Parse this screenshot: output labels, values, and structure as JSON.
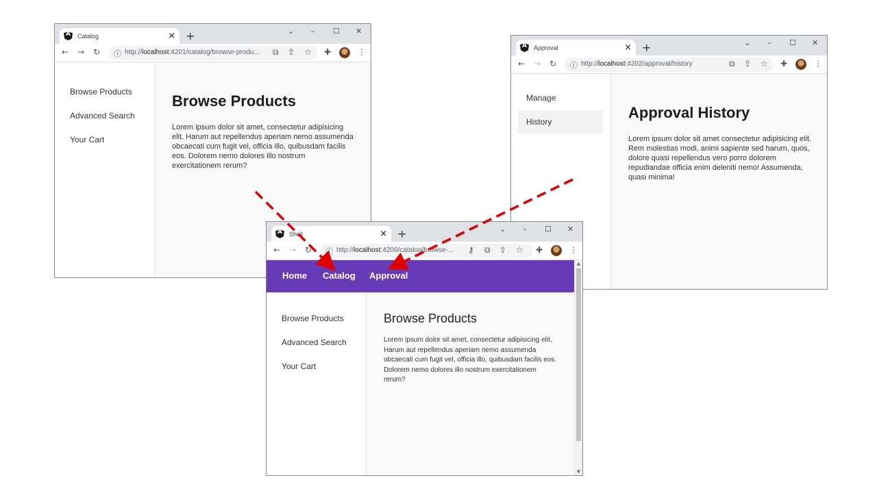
{
  "catalog_window": {
    "tab_title": "Catalog",
    "url_prefix": "http://",
    "url_host": "localhost",
    "url_rest": ":4201/catalog/browse-produ...",
    "nav": [
      "Browse Products",
      "Advanced Search",
      "Your Cart"
    ],
    "heading": "Browse Products",
    "body": "Lorem ipsum dolor sit amet, consectetur adipisicing elit. Harum aut repellendus aperiam nemo assumenda obcaecati cum fugit vel, officia illo, quibusdam facilis eos. Dolorem nemo dolores illo nostrum exercitationem rerum?"
  },
  "approval_window": {
    "tab_title": "Approval",
    "url_prefix": "http://",
    "url_host": "localhost",
    "url_rest": ":4202/approval/history",
    "nav": [
      "Manage",
      "History"
    ],
    "active_nav": "History",
    "heading": "Approval History",
    "body": "Lorem ipsum dolor sit amet consectetur adipisicing elit. Rem molestias modi, animi sapiente sed harum, quos, dolore quasi repellendus vero porro dolorem repudiandae officia enim deleniti nemo! Assumenda, quasi minima!"
  },
  "shell_window": {
    "tab_title": "Shell",
    "url_prefix": "http://",
    "url_host": "localhost",
    "url_rest": ":4200/catalog/browse-...",
    "top_nav": [
      "Home",
      "Catalog",
      "Approval"
    ],
    "nav": [
      "Browse Products",
      "Advanced Search",
      "Your Cart"
    ],
    "heading": "Browse Products",
    "body": "Lorem ipsum dolor sit amet, consectetur adipisicing elit. Harum aut repellendus aperiam nemo assumenda obcaecati cum fugit vel, officia illo, quibusdam facilis eos. Dolorem nemo dolores illo nostrum exercitationem rerum?"
  },
  "browser_chrome": {
    "new_tab": "+",
    "tab_close": "×",
    "win_controls": [
      "⌄",
      "–",
      "☐",
      "✕"
    ],
    "back": "←",
    "forward": "→",
    "reload": "↻",
    "info": "ⓘ",
    "menu": "⋮",
    "icons": [
      "open-in-new-icon",
      "share-icon",
      "star-icon",
      "puzzle-icon",
      "key-icon",
      "avatar-icon"
    ]
  },
  "colors": {
    "shell_bar": "#673ab7",
    "arrow": "#e00000",
    "content_bg": "#f9f9f9"
  }
}
